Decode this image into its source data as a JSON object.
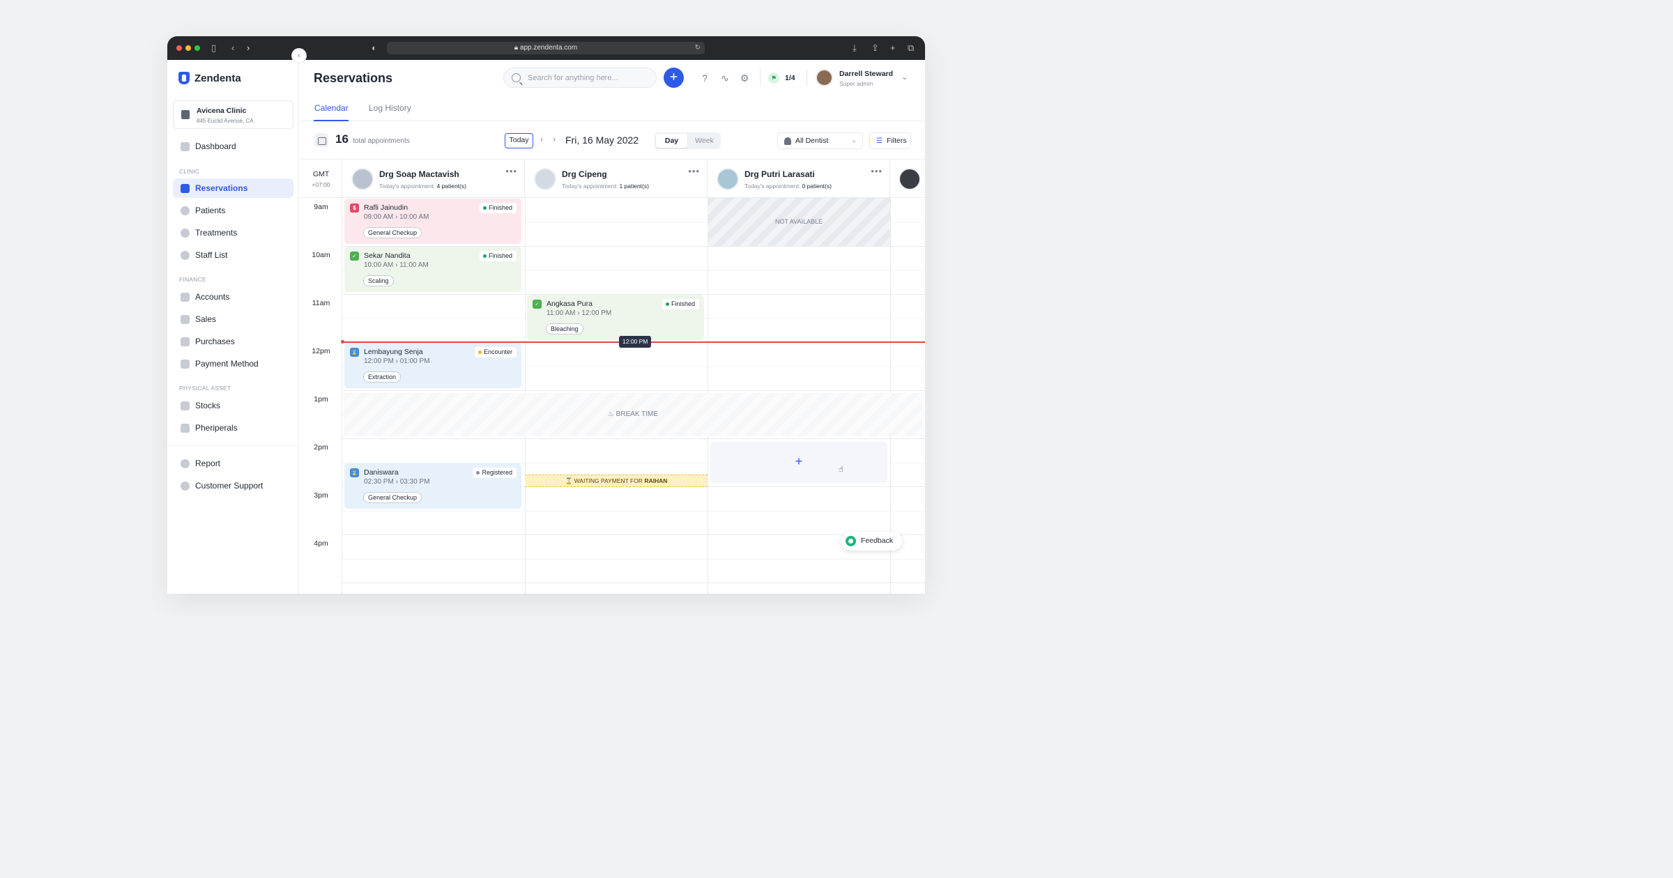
{
  "browser": {
    "url": "app.zendenta.com",
    "colors": {
      "close": "#ff5f57",
      "minimize": "#febc2e",
      "maximize": "#28c840"
    }
  },
  "sidebar": {
    "brand": "Zendenta",
    "clinic": {
      "name": "Avicena Clinic",
      "address": "845 Euclid Avenue, CA"
    },
    "items": [
      {
        "label": "Dashboard"
      },
      {
        "section": "CLINIC"
      },
      {
        "label": "Reservations",
        "active": true
      },
      {
        "label": "Patients"
      },
      {
        "label": "Treatments"
      },
      {
        "label": "Staff List"
      },
      {
        "section": "FINANCE"
      },
      {
        "label": "Accounts"
      },
      {
        "label": "Sales"
      },
      {
        "label": "Purchases"
      },
      {
        "label": "Payment Method"
      },
      {
        "section": "PHYSICAL ASSET"
      },
      {
        "label": "Stocks"
      },
      {
        "label": "Pheriperals"
      },
      {
        "label": "Report"
      },
      {
        "label": "Customer Support"
      }
    ]
  },
  "header": {
    "title": "Reservations",
    "search_placeholder": "Search for anything here...",
    "flag_count": "1/4",
    "user": {
      "name": "Darrell Steward",
      "role": "Super admin"
    }
  },
  "tabs": [
    {
      "label": "Calendar",
      "active": true
    },
    {
      "label": "Log History"
    }
  ],
  "toolbar": {
    "total": "16",
    "total_label": "total appointments",
    "today": "Today",
    "date": "Fri, 16 May 2022",
    "view_day": "Day",
    "view_week": "Week",
    "dentist_filter": "All Dentist",
    "filters": "Filters"
  },
  "calendar": {
    "gmt": "GMT",
    "gmt_offset": "+07:00",
    "today_prefix": "Today's appointment:",
    "doctors": [
      {
        "name": "Drg Soap Mactavish",
        "count": "4 patient(s)"
      },
      {
        "name": "Drg Cipeng",
        "count": "1 patient(s)"
      },
      {
        "name": "Drg Putri Larasati",
        "count": "0 patient(s)"
      }
    ],
    "hours": [
      "9am",
      "10am",
      "11am",
      "12pm",
      "1pm",
      "2pm",
      "3pm",
      "4pm"
    ],
    "appointments": [
      {
        "patient": "Rafli Jainudin",
        "start": "09:00 AM",
        "end": "10:00 AM",
        "treatment": "General Checkup",
        "status": "Finished",
        "icon": "$",
        "color": "#fce8ec",
        "icon_color": "#e2476a",
        "dot": "#22a35b"
      },
      {
        "patient": "Sekar Nandita",
        "start": "10:00 AM",
        "end": "11:00 AM",
        "treatment": "Scaling",
        "status": "Finished",
        "icon": "✓",
        "color": "#eef5ea",
        "icon_color": "#4caf50",
        "dot": "#22a35b"
      },
      {
        "patient": "Angkasa Pura",
        "start": "11:00 AM",
        "end": "12:00 PM",
        "treatment": "Bleaching",
        "status": "Finished",
        "icon": "✓",
        "color": "#eef5ea",
        "icon_color": "#4caf50",
        "dot": "#22a35b"
      },
      {
        "patient": "Lembayung Senja",
        "start": "12:00 PM",
        "end": "01:00 PM",
        "treatment": "Extraction",
        "status": "Encounter",
        "icon": "⌛",
        "color": "#e6f1fb",
        "icon_color": "#3d8fe0",
        "dot": "#f0b429"
      },
      {
        "patient": "Daniswara",
        "start": "02:30 PM",
        "end": "03:30 PM",
        "treatment": "General Checkup",
        "status": "Registered",
        "icon": "⌛",
        "color": "#e6f1fb",
        "icon_color": "#3d8fe0",
        "dot": "#8a90a0"
      }
    ],
    "time_sep": "›",
    "not_available": "NOT AVAILABLE",
    "break_time": "BREAK TIME",
    "waiting": {
      "prefix": "WAITING PAYMENT FOR",
      "name": "RAIHAN"
    },
    "now": "12:00 PM",
    "feedback": "Feedback"
  }
}
